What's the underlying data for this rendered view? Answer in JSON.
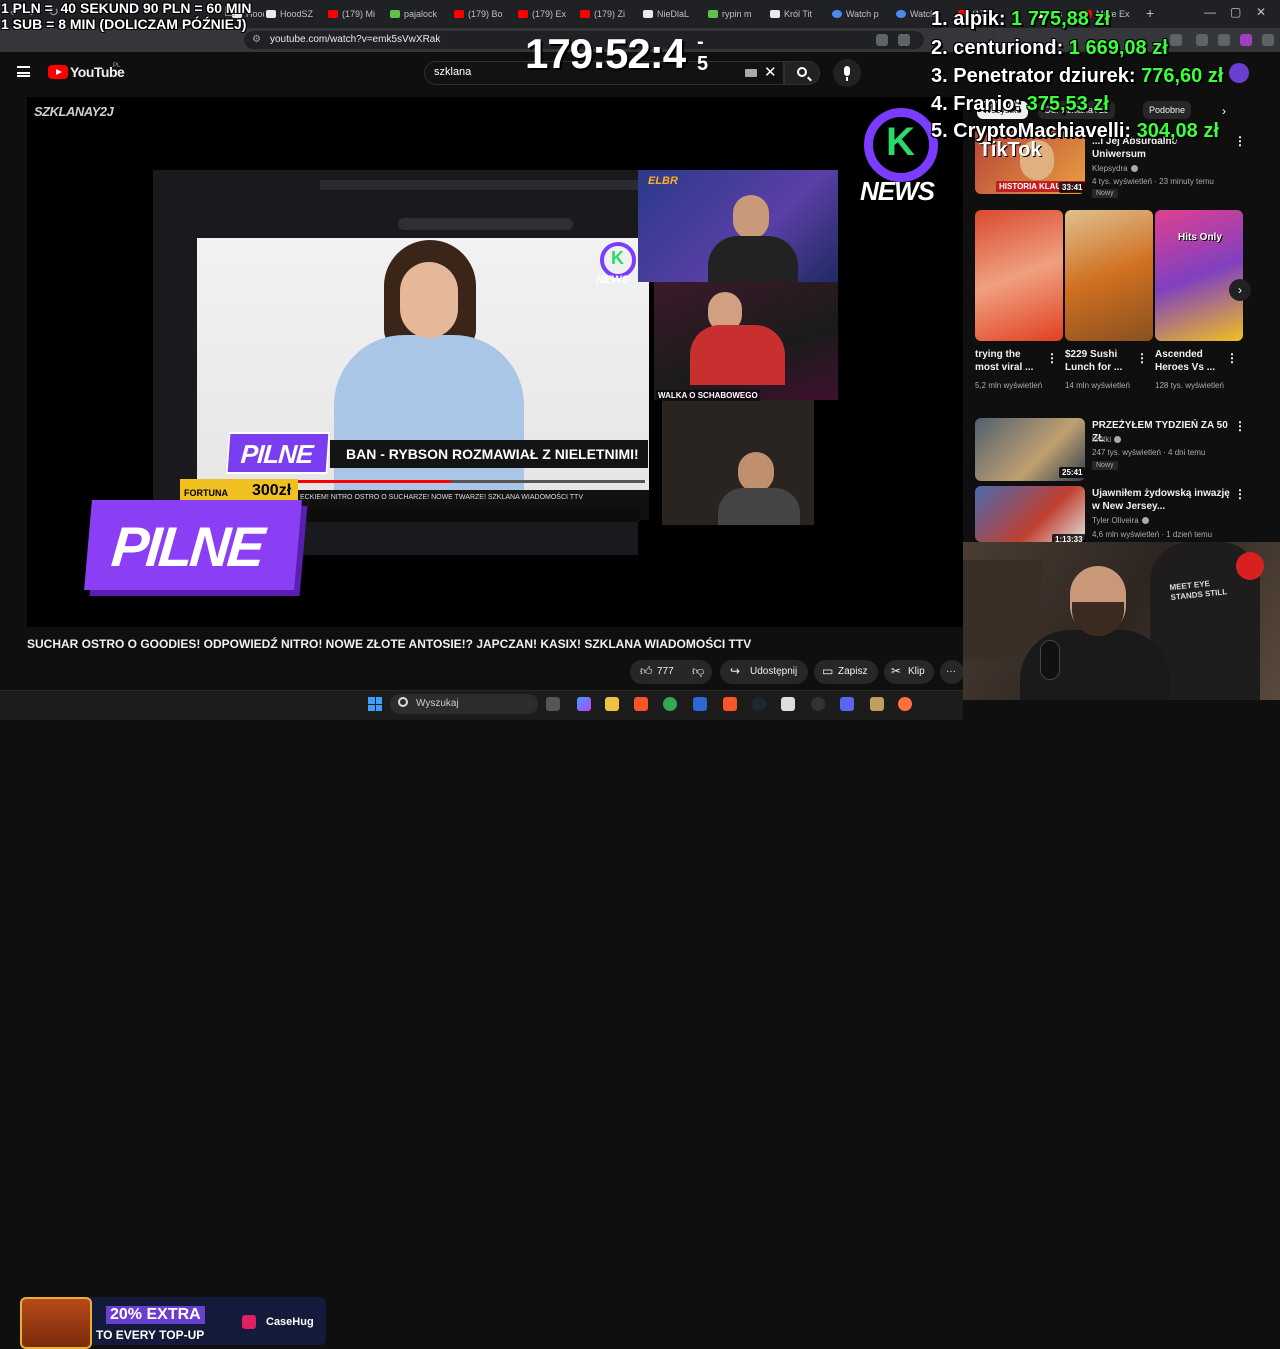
{
  "browser": {
    "tabs": [
      {
        "label": "Hood...",
        "fav": "x"
      },
      {
        "label": "HoodSZ",
        "fav": "x"
      },
      {
        "label": "(179) Mi",
        "fav": "yt"
      },
      {
        "label": "pajalock",
        "fav": "g"
      },
      {
        "label": "(179) Bo",
        "fav": "yt"
      },
      {
        "label": "(179) Ex",
        "fav": "yt"
      },
      {
        "label": "(179) Zi",
        "fav": "yt"
      },
      {
        "label": "NieDlaL",
        "fav": "x"
      },
      {
        "label": "rypin m",
        "fav": "g"
      },
      {
        "label": "Król Tit",
        "fav": "x"
      },
      {
        "label": "Watch p",
        "fav": "b"
      },
      {
        "label": "Watch",
        "fav": "b"
      },
      {
        "label": "(179",
        "fav": "yt"
      },
      {
        "label": "Mo",
        "fav": "x"
      },
      {
        "label": "More Ex",
        "fav": "yt"
      }
    ],
    "url": "youtube.com/watch?v=emk5sVwXRak"
  },
  "youtube": {
    "logo_text": "YouTube",
    "country_code": "PL",
    "search_value": "szklana"
  },
  "overlay": {
    "rates_line1": "1 PLN =  40 SEKUND 90 PLN = 60 MIN",
    "rates_line2": "1 SUB = 8 MIN (DOLICZAM PÓŹNIEJ)",
    "timer": "179:52:4",
    "timer_sup_top": "-",
    "timer_sup_bottom": "5",
    "leaderboard": [
      {
        "name": "1. alpik:",
        "amount": "1 775,88 zł"
      },
      {
        "name": "2. centuriond:",
        "amount": "1 669,08 zł"
      },
      {
        "name": "3. Penetrator dziurek:",
        "amount": "776,60 zł"
      },
      {
        "name": "4. Franio:",
        "amount": "375,53 zł"
      },
      {
        "name": "5. CryptoMachiavelli:",
        "amount": "304,08 zł"
      }
    ],
    "tiktok_label": "TikTok"
  },
  "player": {
    "brand_tag": "SZKLANAY2J",
    "knews_letter": "K",
    "knews_word": "NEWS",
    "pilne": "PILNE",
    "ban_caption": "BAN - RYBSON ROZMAWIAŁ Z NIELETNIMI!",
    "fortuna_label": "FORTUNA",
    "fortuna_amount": "300zł",
    "walka_label": "WALKA O SCHABOWEGO",
    "elbr_label": "ELBR",
    "ticker": "ECKIEM! NITRO OSTRO O SUCHARZE! NOWE TWARZE! SZKLANA WIADOMOŚCI TTV"
  },
  "video": {
    "title": "SUCHAR OSTRO O GOODIES! ODPOWIEDŹ NITRO! NOWE ZŁOTE ANTOSIE!? JAPCZAN! KASIX! SZKLANA WIADOMOŚCI TTV",
    "likes": "777",
    "share_label": "Udostępnij",
    "save_label": "Zapisz",
    "clip_label": "Klip",
    "more_label": "···"
  },
  "sidebar": {
    "chips": [
      {
        "label": "Wszystko",
        "active": true
      },
      {
        "label": "Od: SzklanaY2J",
        "active": false
      },
      {
        "label": "Podobne",
        "active": false
      }
    ],
    "top_item": {
      "title": "...i Jej Absurdalne Uniwersum",
      "channel": "Klepsydra",
      "meta": "4 tys. wyświetleń · 23 minuty temu",
      "badge": "Nowy",
      "duration": "33:41",
      "thumb_caption": "HISTORIA KLAUDELL"
    },
    "shorts": [
      {
        "title": "trying the most viral ...",
        "views": "5,2 mln wyświetleń"
      },
      {
        "title": "$229 Sushi Lunch for ...",
        "views": "14 mln wyświetleń"
      },
      {
        "title": "Ascended Heroes Vs ...",
        "views": "128 tys. wyświetleń",
        "thumb_text": "Hits Only"
      }
    ],
    "items": [
      {
        "title": "PRZEŻYŁEM TYDZIEŃ ZA 50 ZŁ",
        "channel": "krutki",
        "meta": "247 tys. wyświetleń · 4 dni temu",
        "badge": "Nowy",
        "duration": "25:41"
      },
      {
        "title": "Ujawniłem żydowską inwazję w New Jersey...",
        "channel": "Tyler Oliveira",
        "meta": "4,6 mln wyświetleń · 1 dzień temu",
        "duration": "1:13:33"
      }
    ]
  },
  "promo": {
    "line1": "20% EXTRA",
    "line2": "TO EVERY TOP-UP",
    "brand": "CaseHug"
  },
  "streamcam": {
    "shirt_text": "MEET EYE STANDS STILL"
  },
  "taskbar": {
    "search_placeholder": "Wyszukaj"
  },
  "colors": {
    "accent_purple": "#7b3df0",
    "leader_green": "#3cff3c",
    "yt_red": "#ff0000"
  }
}
